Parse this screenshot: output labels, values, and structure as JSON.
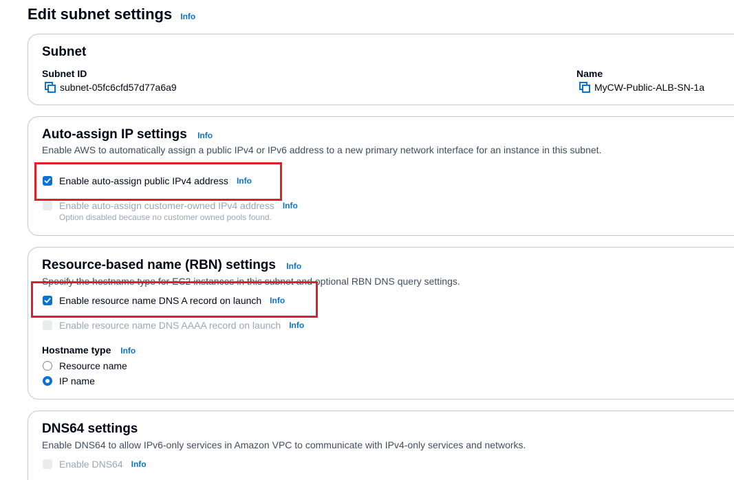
{
  "page": {
    "title": "Edit subnet settings",
    "info": "Info"
  },
  "subnet": {
    "title": "Subnet",
    "subnet_id_label": "Subnet ID",
    "subnet_id_value": "subnet-05fc6cfd57d77a6a9",
    "name_label": "Name",
    "name_value": "MyCW-Public-ALB-SN-1a"
  },
  "auto_assign": {
    "title": "Auto-assign IP settings",
    "info": "Info",
    "description": "Enable AWS to automatically assign a public IPv4 or IPv6 address to a new primary network interface for an instance in this subnet.",
    "ipv4_label": "Enable auto-assign public IPv4 address",
    "ipv4_checked": true,
    "ipv4_info": "Info",
    "customer_owned_label": "Enable auto-assign customer-owned IPv4 address",
    "customer_owned_info": "Info",
    "customer_owned_disabled_note": "Option disabled because no customer owned pools found."
  },
  "rbn": {
    "title": "Resource-based name (RBN) settings",
    "info": "Info",
    "description": "Specify the hostname type for EC2 instances in this subnet and optional RBN DNS query settings.",
    "dns_a_label": "Enable resource name DNS A record on launch",
    "dns_a_checked": true,
    "dns_a_info": "Info",
    "dns_aaaa_label": "Enable resource name DNS AAAA record on launch",
    "dns_aaaa_info": "Info",
    "hostname_type_label": "Hostname type",
    "hostname_type_info": "Info",
    "hostname_options": [
      "Resource name",
      "IP name"
    ],
    "hostname_selected": "IP name"
  },
  "dns64": {
    "title": "DNS64 settings",
    "description": "Enable DNS64 to allow IPv6-only services in Amazon VPC to communicate with IPv4-only services and networks.",
    "enable_label": "Enable DNS64",
    "enable_info": "Info"
  },
  "colors": {
    "accent": "#0972d3",
    "highlight": "#e01e2a",
    "border": "#c6c6cd",
    "disabled_text": "#9ba7b6"
  }
}
